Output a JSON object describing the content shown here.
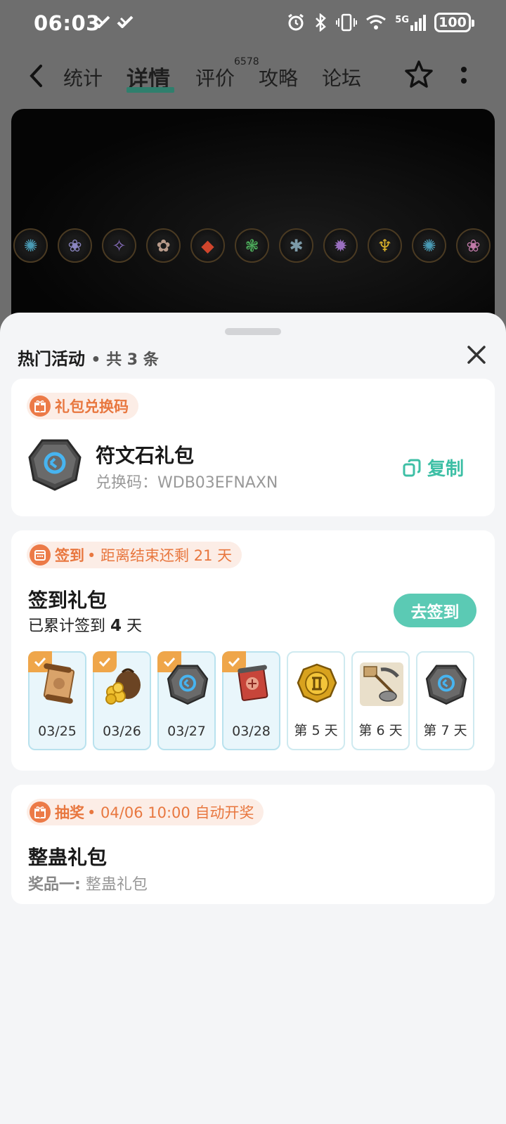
{
  "status_bar": {
    "time": "06:03",
    "network": "5G",
    "battery": "100"
  },
  "nav": {
    "tabs": [
      "统计",
      "详情",
      "评价",
      "攻略",
      "论坛"
    ],
    "active_tab": "详情",
    "review_count": "6578"
  },
  "sheet": {
    "title": "热门活动",
    "count_text": "• 共 3 条"
  },
  "gift_code": {
    "tag": "礼包兑换码",
    "name": "符文石礼包",
    "code_label": "兑换码：",
    "code": "WDB03EFNAXN",
    "copy_label": "复制"
  },
  "signin": {
    "tag": "签到",
    "tag_sub": "• 距离结束还剩 21 天",
    "name": "签到礼包",
    "progress_prefix": "已累计签到",
    "progress_days": "4",
    "progress_suffix": "天",
    "button": "去签到",
    "days": [
      {
        "label": "03/25",
        "done": true,
        "item": "scroll"
      },
      {
        "label": "03/26",
        "done": true,
        "item": "gold-bag"
      },
      {
        "label": "03/27",
        "done": true,
        "item": "rune-stone"
      },
      {
        "label": "03/28",
        "done": true,
        "item": "red-scroll"
      },
      {
        "label": "第 5 天",
        "done": false,
        "item": "gold-medal"
      },
      {
        "label": "第 6 天",
        "done": false,
        "item": "tools"
      },
      {
        "label": "第 7 天",
        "done": false,
        "item": "rune-stone"
      }
    ]
  },
  "lottery": {
    "tag": "抽奖",
    "tag_sub": "• 04/06 10:00 自动开奖",
    "name": "整蛊礼包",
    "prize_label": "奖品一:",
    "prize": "整蛊礼包"
  },
  "colors": {
    "accent": "#5bcab4",
    "tag_orange": "#ec7a47",
    "check": "#efa64a"
  }
}
